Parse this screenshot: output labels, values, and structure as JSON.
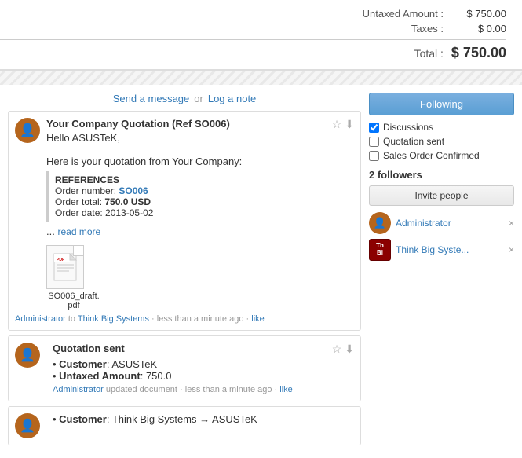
{
  "summary": {
    "untaxed_label": "Untaxed Amount :",
    "untaxed_value": "$ 750.00",
    "taxes_label": "Taxes :",
    "taxes_value": "$ 0.00",
    "total_label": "Total :",
    "total_value": "$ 750.00"
  },
  "tabs": {
    "send_message": "Send a message",
    "or": "or",
    "log_note": "Log a note"
  },
  "message1": {
    "title": "Your Company Quotation (Ref SO006)",
    "body_line1": "Hello ASUSTeK,",
    "body_line2": "Here is your quotation from Your Company:",
    "ref_title": "REFERENCES",
    "ref_order_num_label": "Order number: ",
    "ref_order_num": "SO006",
    "ref_order_total_label": "Order total: ",
    "ref_order_total": "750.0 USD",
    "ref_order_date_label": "Order date: ",
    "ref_order_date": "2013-05-02",
    "ellipsis": "...",
    "read_more": "read more",
    "attachment_name": "SO006_draft.pdf",
    "footer_author": "Administrator",
    "footer_to": "to",
    "footer_to_name": "Think Big Systems",
    "footer_time": "less than a minute ago",
    "footer_separator": "·",
    "footer_like": "like",
    "star_icon": "☆",
    "download_icon": "⬇"
  },
  "message2": {
    "title": "Quotation sent",
    "customer_label": "Customer",
    "customer_value": "ASUSTeK",
    "amount_label": "Untaxed Amount",
    "amount_value": "750.0",
    "footer_author": "Administrator",
    "footer_action": "updated document",
    "footer_time": "less than a minute ago",
    "footer_separator": "·",
    "footer_like": "like",
    "star_icon": "☆",
    "download_icon": "⬇"
  },
  "message3": {
    "customer_label": "Customer",
    "customer_from": "Think Big Systems",
    "customer_arrow": "→",
    "customer_to": "ASUSTeK"
  },
  "sidebar": {
    "following_btn": "Following",
    "discussions_label": "Discussions",
    "discussions_checked": true,
    "quotation_sent_label": "Quotation sent",
    "quotation_sent_checked": false,
    "sales_order_label": "Sales Order Confirmed",
    "sales_order_checked": false,
    "followers_title": "2 followers",
    "invite_btn": "Invite people",
    "follower1_name": "Administrator",
    "follower2_name": "Think Big Syste...",
    "remove_icon": "×"
  }
}
